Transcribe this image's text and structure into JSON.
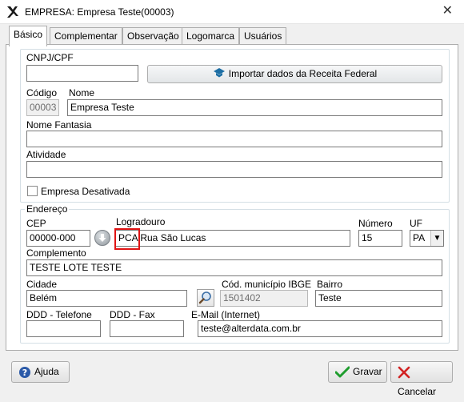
{
  "window": {
    "title": "EMPRESA: Empresa Teste(00003)",
    "close_label": "✕"
  },
  "tabs": [
    {
      "label": "Básico",
      "active": true
    },
    {
      "label": "Complementar"
    },
    {
      "label": "Observação"
    },
    {
      "label": "Logomarca"
    },
    {
      "label": "Usuários"
    }
  ],
  "basic": {
    "cnpj_label": "CNPJ/CPF",
    "cnpj_value": "",
    "import_button_label": "Importar dados da Receita Federal",
    "codigo_label": "Código",
    "codigo_value": "00003",
    "nome_label": "Nome",
    "nome_value": "Empresa Teste",
    "nome_fantasia_label": "Nome Fantasia",
    "nome_fantasia_value": "",
    "atividade_label": "Atividade",
    "atividade_value": "",
    "desativada_label": "Empresa Desativada"
  },
  "endereco": {
    "legend": "Endereço",
    "cep_label": "CEP",
    "cep_value": "00000-000",
    "logradouro_label": "Logradouro",
    "logradouro_value": "PCA Rua São Lucas",
    "numero_label": "Número",
    "numero_value": "15",
    "uf_label": "UF",
    "uf_value": "PA",
    "complemento_label": "Complemento",
    "complemento_value": "TESTE LOTE TESTE",
    "cidade_label": "Cidade",
    "cidade_value": "Belém",
    "cod_municipio_label": "Cód. município IBGE",
    "cod_municipio_value": "1501402",
    "bairro_label": "Bairro",
    "bairro_value": "Teste",
    "ddd_telefone_label": "DDD - Telefone",
    "ddd_telefone_value": "",
    "ddd_fax_label": "DDD - Fax",
    "ddd_fax_value": "",
    "email_label": "E-Mail (Internet)",
    "email_value": "teste@alterdata.com.br"
  },
  "footer": {
    "help_label": "Ajuda",
    "save_label": "Gravar",
    "cancel_label": "Cancelar"
  },
  "colors": {
    "highlight_box": "#e01414",
    "save_check": "#1f9d2e",
    "cancel_x": "#d22323",
    "import_icon": "#1c6ea4",
    "help_icon": "#2b5aa8"
  }
}
